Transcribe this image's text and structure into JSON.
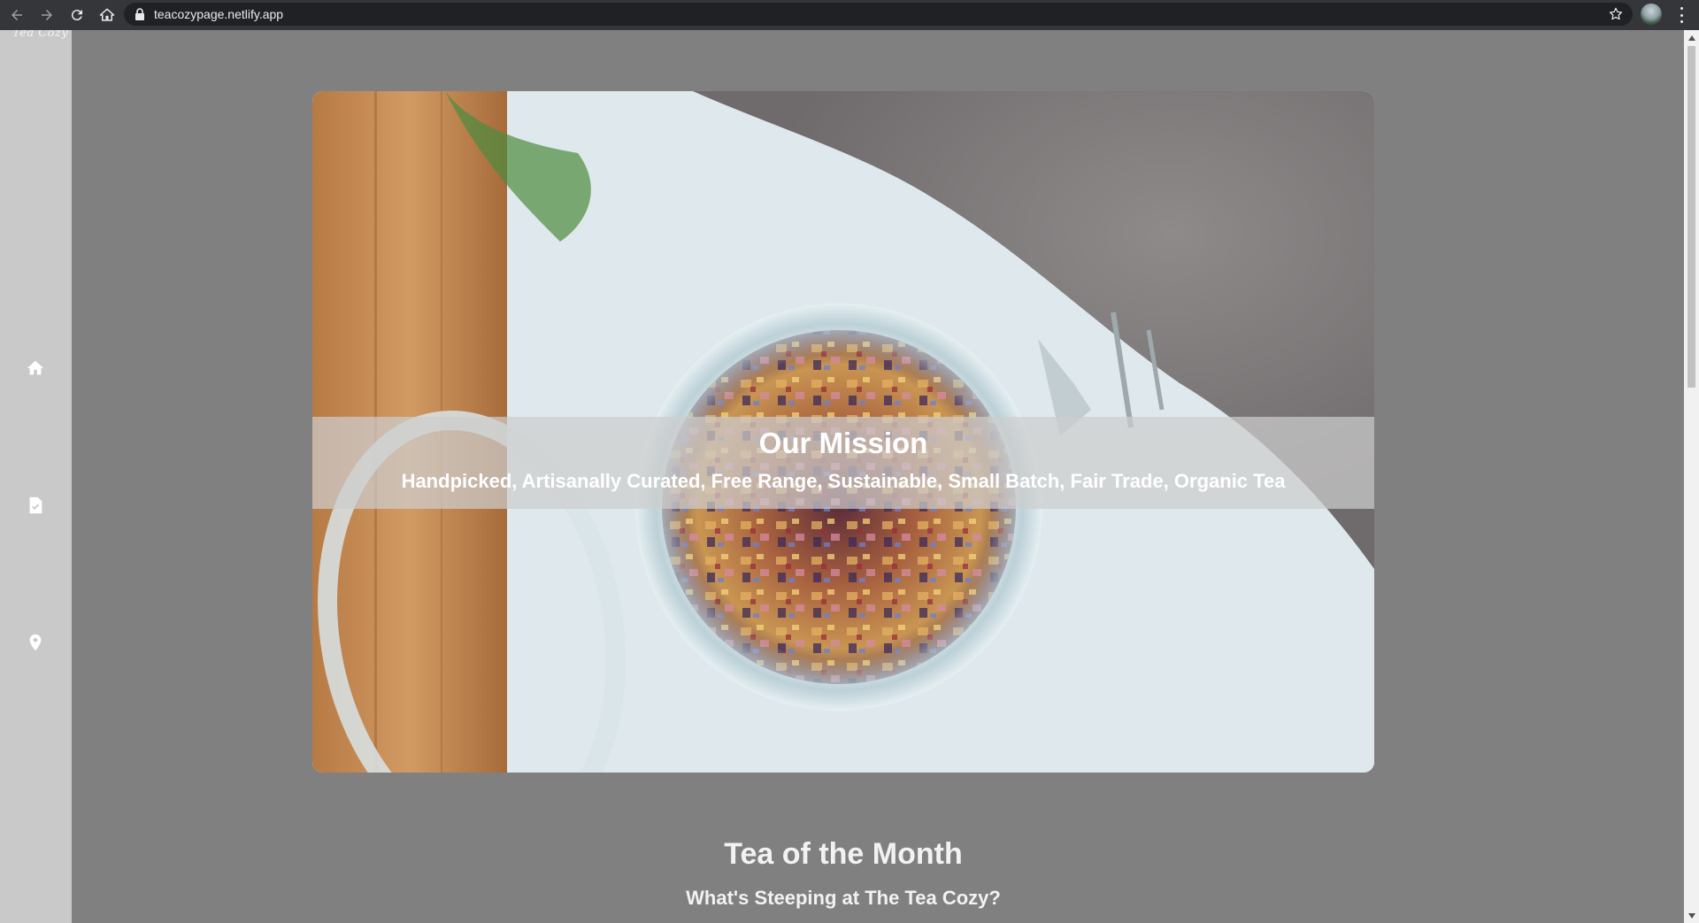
{
  "browser": {
    "url": "teacozypage.netlify.app",
    "icons": [
      "back-arrow-icon",
      "forward-arrow-icon",
      "reload-icon",
      "home-icon",
      "lock-icon",
      "star-icon",
      "profile-avatar",
      "kebab-menu-icon"
    ]
  },
  "sidebar": {
    "logo": "Tea Cozy",
    "items": [
      {
        "icon": "home-icon"
      },
      {
        "icon": "document-check-icon"
      },
      {
        "icon": "location-pin-icon"
      }
    ]
  },
  "hero": {
    "title": "Our Mission",
    "tagline": "Handpicked, Artisanally Curated, Free Range, Sustainable, Small Batch, Fair Trade, Organic Tea"
  },
  "tea_of_month": {
    "title": "Tea of the Month",
    "subtitle": "What's Steeping at The Tea Cozy?"
  },
  "colors": {
    "page_background": "#808080",
    "sidebar_background": "#c9c9c9",
    "browser_chrome": "#35363a",
    "heading_text": "#f2f2f2"
  }
}
